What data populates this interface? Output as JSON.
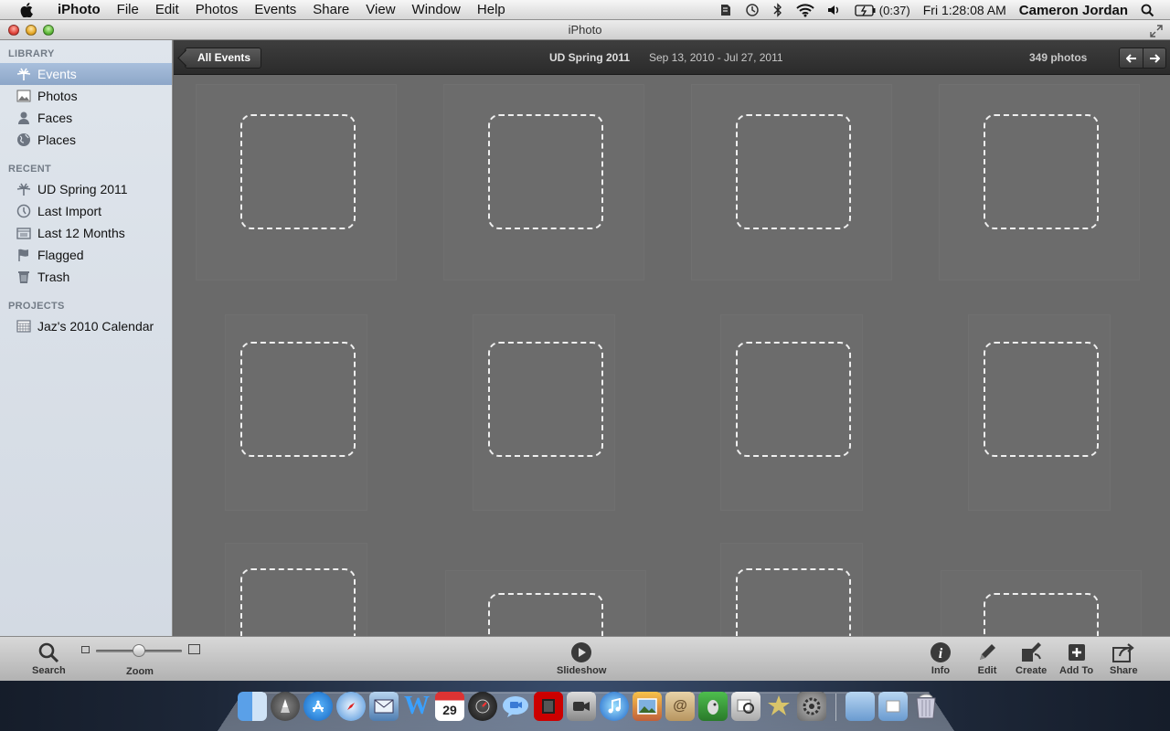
{
  "menubar": {
    "app_name": "iPhoto",
    "items": [
      "File",
      "Edit",
      "Photos",
      "Events",
      "Share",
      "View",
      "Window",
      "Help"
    ],
    "battery": "(0:37)",
    "clock": "Fri 1:28:08 AM",
    "user": "Cameron Jordan"
  },
  "window": {
    "title": "iPhoto"
  },
  "sidebar": {
    "library_header": "LIBRARY",
    "library": [
      {
        "label": "Events",
        "icon": "palm-tree-icon",
        "selected": true
      },
      {
        "label": "Photos",
        "icon": "photo-icon"
      },
      {
        "label": "Faces",
        "icon": "person-icon"
      },
      {
        "label": "Places",
        "icon": "globe-icon"
      }
    ],
    "recent_header": "RECENT",
    "recent": [
      {
        "label": "UD Spring 2011",
        "icon": "palm-tree-icon"
      },
      {
        "label": "Last Import",
        "icon": "clock-icon"
      },
      {
        "label": "Last 12 Months",
        "icon": "calendar-box-icon"
      },
      {
        "label": "Flagged",
        "icon": "flag-icon"
      },
      {
        "label": "Trash",
        "icon": "trash-icon"
      }
    ],
    "projects_header": "PROJECTS",
    "projects": [
      {
        "label": "Jaz's 2010 Calendar",
        "icon": "calendar-icon"
      }
    ]
  },
  "header": {
    "back_button": "All Events",
    "event_title": "UD Spring 2011",
    "event_dates": "Sep 13, 2010 - Jul 27, 2011",
    "photo_count": "349 photos"
  },
  "toolbar": {
    "search": "Search",
    "zoom": "Zoom",
    "zoom_level": 0.5,
    "slideshow": "Slideshow",
    "info": "Info",
    "edit": "Edit",
    "create": "Create",
    "add_to": "Add To",
    "share": "Share"
  },
  "dock": {
    "calendar_day": "29",
    "apps": [
      "finder",
      "launchpad",
      "app-store",
      "safari",
      "mail",
      "word",
      "ical",
      "dashboard",
      "ichat",
      "photobooth",
      "facetime",
      "itunes",
      "iphoto",
      "address-book",
      "evernote",
      "preview",
      "imovie",
      "system-preferences"
    ]
  },
  "colors": {
    "selected_row": "#8da6c8",
    "header_bar": "#333333",
    "grid_bg": "#6a6a6a"
  }
}
